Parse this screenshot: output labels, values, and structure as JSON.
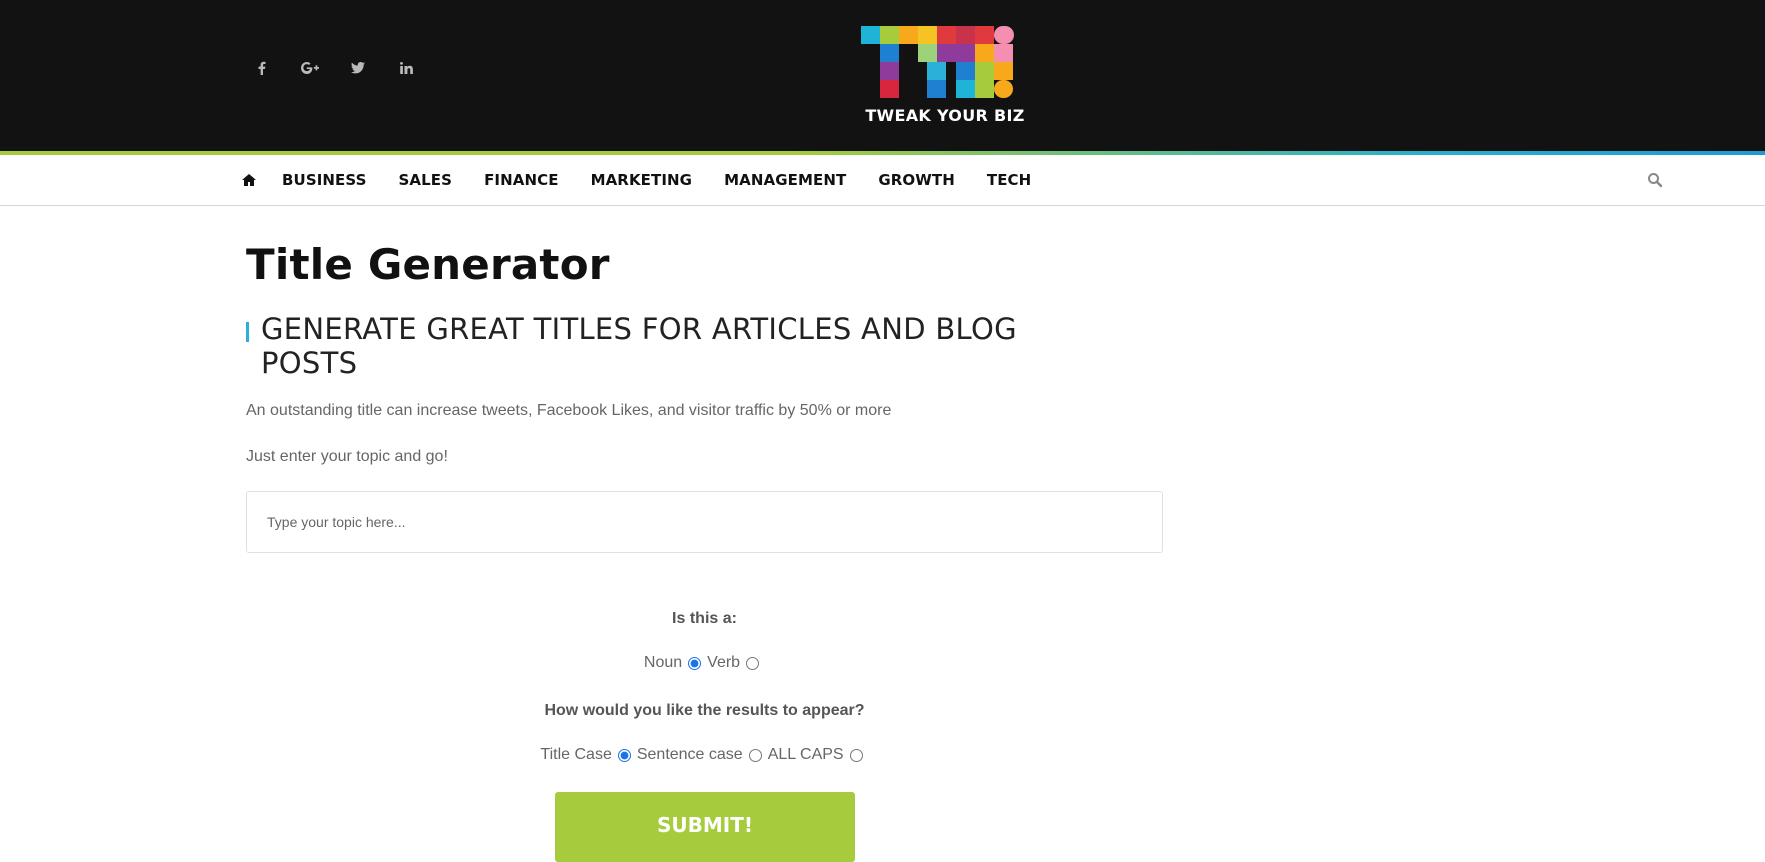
{
  "header": {
    "social": [
      {
        "icon": "facebook-icon",
        "glyph": "f"
      },
      {
        "icon": "google-plus-icon",
        "glyph": "G+"
      },
      {
        "icon": "twitter-icon",
        "glyph": "t"
      },
      {
        "icon": "linkedin-icon",
        "glyph": "in"
      }
    ],
    "logo_mark": "TYB",
    "logo_text": "TWEAK YOUR BIZ"
  },
  "nav": {
    "home_icon": "home-icon",
    "items": [
      "BUSINESS",
      "SALES",
      "FINANCE",
      "MARKETING",
      "MANAGEMENT",
      "GROWTH",
      "TECH"
    ],
    "search_icon": "search-icon"
  },
  "main": {
    "title": "Title Generator",
    "subheading": "GENERATE GREAT TITLES FOR ARTICLES AND BLOG POSTS",
    "intro": "An outstanding title can increase tweets, Facebook Likes, and visitor traffic by 50% or more",
    "prompt": "Just enter your topic and go!",
    "topic_placeholder": "Type your topic here...",
    "topic_value": "",
    "question1": "Is this a:",
    "type_options": [
      {
        "label": "Noun",
        "checked": true
      },
      {
        "label": "Verb",
        "checked": false
      }
    ],
    "question2": "How would you like the results to appear?",
    "case_options": [
      {
        "label": "Title Case",
        "checked": true
      },
      {
        "label": "Sentence case",
        "checked": false
      },
      {
        "label": "ALL CAPS",
        "checked": false
      }
    ],
    "submit_label": "SUBMIT!"
  },
  "colors": {
    "header_bg": "#121212",
    "accent_green": "#a6cb3c",
    "accent_blue": "#2bb0d9"
  }
}
